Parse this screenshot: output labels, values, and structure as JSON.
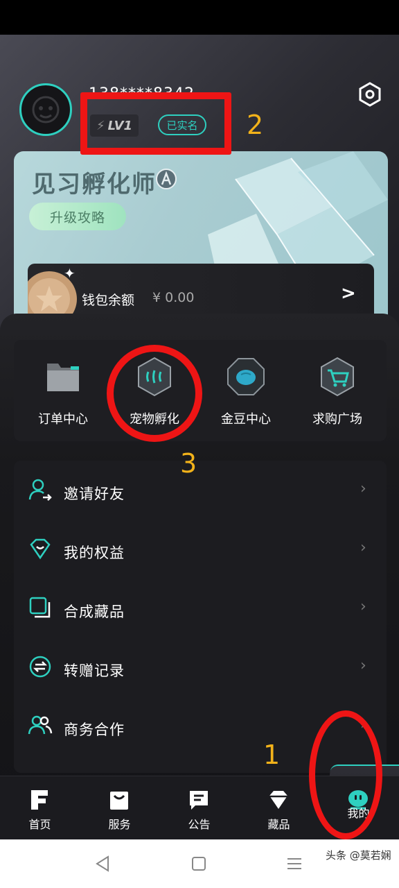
{
  "profile": {
    "username": "138****8342",
    "level": "LV1",
    "verified_label": "已实名"
  },
  "level_card": {
    "title": "见习孵化师",
    "upgrade_label": "升级攻略"
  },
  "wallet": {
    "label": "钱包余额",
    "amount": "¥ 0.00",
    "arrow": ">"
  },
  "tiles": [
    {
      "label": "订单中心",
      "icon": "folder-icon"
    },
    {
      "label": "宠物孵化",
      "icon": "pet-hatch-icon"
    },
    {
      "label": "金豆中心",
      "icon": "gold-bean-icon"
    },
    {
      "label": "求购广场",
      "icon": "cart-icon"
    }
  ],
  "menu": [
    {
      "label": "邀请好友",
      "icon": "invite-friend-icon"
    },
    {
      "label": "我的权益",
      "icon": "rights-icon"
    },
    {
      "label": "合成藏品",
      "icon": "compose-icon"
    },
    {
      "label": "转赠记录",
      "icon": "transfer-icon"
    },
    {
      "label": "商务合作",
      "icon": "business-icon"
    }
  ],
  "tabbar": [
    {
      "label": "首页",
      "icon": "home-icon"
    },
    {
      "label": "服务",
      "icon": "bag-icon"
    },
    {
      "label": "公告",
      "icon": "notice-icon"
    },
    {
      "label": "藏品",
      "icon": "diamond-icon"
    },
    {
      "label": "我的",
      "icon": "profile-face-icon",
      "active": true
    }
  ],
  "annotations": {
    "one": "1",
    "two": "2",
    "three": "3"
  },
  "watermark": "头条 @莫若娴",
  "colors": {
    "accent": "#2ed0c0",
    "annotation_red": "#ee1515",
    "annotation_number": "#f2b21a"
  }
}
